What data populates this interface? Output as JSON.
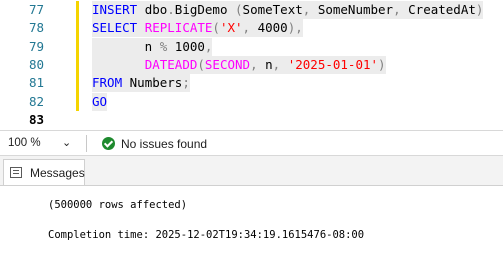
{
  "editor": {
    "line_numbers": [
      "77",
      "78",
      "79",
      "80",
      "81",
      "82",
      "83"
    ],
    "current_line": "83",
    "lines": [
      [
        {
          "t": "INSERT ",
          "c": "kw"
        },
        {
          "t": "dbo",
          "c": "plain"
        },
        {
          "t": ".",
          "c": "gray"
        },
        {
          "t": "BigDemo ",
          "c": "plain"
        },
        {
          "t": "(",
          "c": "gray"
        },
        {
          "t": "SomeText",
          "c": "plain"
        },
        {
          "t": ", ",
          "c": "gray"
        },
        {
          "t": "SomeNumber",
          "c": "plain"
        },
        {
          "t": ", ",
          "c": "gray"
        },
        {
          "t": "CreatedAt",
          "c": "plain"
        },
        {
          "t": ")",
          "c": "gray"
        }
      ],
      [
        {
          "t": "SELECT ",
          "c": "kw"
        },
        {
          "t": "REPLICATE",
          "c": "fn"
        },
        {
          "t": "(",
          "c": "gray"
        },
        {
          "t": "'X'",
          "c": "str"
        },
        {
          "t": ", ",
          "c": "gray"
        },
        {
          "t": "4000",
          "c": "plain"
        },
        {
          "t": "),",
          "c": "gray"
        }
      ],
      [
        {
          "t": "       n ",
          "c": "plain"
        },
        {
          "t": "%",
          "c": "gray"
        },
        {
          "t": " 1000",
          "c": "plain"
        },
        {
          "t": ",",
          "c": "gray"
        }
      ],
      [
        {
          "t": "       ",
          "c": "plain"
        },
        {
          "t": "DATEADD",
          "c": "fn"
        },
        {
          "t": "(",
          "c": "gray"
        },
        {
          "t": "SECOND",
          "c": "fn"
        },
        {
          "t": ", ",
          "c": "gray"
        },
        {
          "t": "n",
          "c": "plain"
        },
        {
          "t": ", ",
          "c": "gray"
        },
        {
          "t": "'2025-01-01'",
          "c": "str"
        },
        {
          "t": ")",
          "c": "gray"
        }
      ],
      [
        {
          "t": "FROM ",
          "c": "kw"
        },
        {
          "t": "Numbers",
          "c": "plain"
        },
        {
          "t": ";",
          "c": "gray"
        }
      ],
      [
        {
          "t": "GO",
          "c": "kw"
        }
      ],
      []
    ]
  },
  "statusbar": {
    "zoom": "100 %",
    "issues": "No issues found"
  },
  "results": {
    "tab_label": "Messages",
    "messages": [
      "(500000 rows affected)",
      "Completion time: 2025-12-02T19:34:19.1615476-08:00"
    ]
  },
  "colors": {
    "keyword": "#0000ff",
    "function": "#ff00ff",
    "string": "#ff0000",
    "line_number": "#237893",
    "change_bar": "#f5d400",
    "success": "#1e8a2e"
  }
}
